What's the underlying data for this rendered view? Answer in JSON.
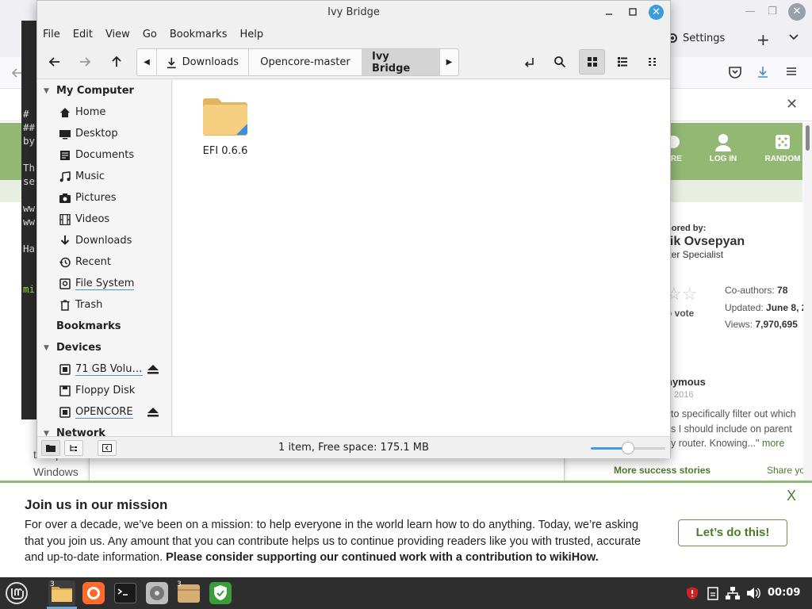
{
  "nemo": {
    "title": "Ivy Bridge",
    "menu": [
      "File",
      "Edit",
      "View",
      "Go",
      "Bookmarks",
      "Help"
    ],
    "path": [
      "Downloads",
      "Opencore-master",
      "Ivy Bridge"
    ],
    "sidebar": {
      "my_computer": "My Computer",
      "places": [
        {
          "label": "Home",
          "icon": "home-icon"
        },
        {
          "label": "Desktop",
          "icon": "desktop-icon"
        },
        {
          "label": "Documents",
          "icon": "documents-icon"
        },
        {
          "label": "Music",
          "icon": "music-icon"
        },
        {
          "label": "Pictures",
          "icon": "camera-icon"
        },
        {
          "label": "Videos",
          "icon": "film-icon"
        },
        {
          "label": "Downloads",
          "icon": "download-icon"
        },
        {
          "label": "Recent",
          "icon": "recent-icon"
        },
        {
          "label": "File System",
          "icon": "drive-icon"
        },
        {
          "label": "Trash",
          "icon": "trash-icon"
        }
      ],
      "bookmarks": "Bookmarks",
      "devices_header": "Devices",
      "devices": [
        {
          "label": "71 GB Volu…",
          "icon": "drive-icon",
          "eject": true
        },
        {
          "label": "Floppy Disk",
          "icon": "floppy-icon",
          "eject": false
        },
        {
          "label": "OPENCORE",
          "icon": "drive-icon",
          "eject": true
        }
      ],
      "network": "Network"
    },
    "files": [
      {
        "name": "EFI 0.6.6",
        "icon": "folder-icon"
      }
    ],
    "status": "1 item, Free space: 175.1 MB",
    "zoom_level": 0.5
  },
  "browser": {
    "settings_label": "Settings",
    "header_items": [
      "ORE",
      "LOG IN",
      "RANDOM"
    ],
    "author": {
      "line1": "-authored by:",
      "name": "arnik Ovsepyan",
      "role": "mputer Specialist"
    },
    "stats": {
      "coauthors_label": "Co-authors:",
      "coauthors": "78",
      "updated_label": "Updated:",
      "updated": "June 8, 2",
      "views_label": "Views:",
      "views": "7,970,695"
    },
    "vote": "o vote",
    "story": {
      "name": "nymous",
      "date": "2016",
      "l1": "to specifically filter out which",
      "l2": "s I should include on parent",
      "l3": "y router. Knowing...\"",
      "more": "more"
    },
    "more_stories": "More success stories",
    "share": "Share yo",
    "left_text": [
      "the quick",
      "Windows"
    ],
    "terminal_lines": [
      "#",
      "##",
      "by",
      "",
      "Th",
      "se",
      "",
      "ww",
      "ww",
      "",
      "Ha",
      "",
      "",
      "mi"
    ]
  },
  "banner": {
    "title": "Join us in our mission",
    "close": "X",
    "text": "For over a decade, we’ve been on a mission: to help everyone in the world learn how to do anything. Today, we’re asking that you join us. Any amount that you can contribute helps us to continue providing readers like you with trusted, accurate and up-to-date information. ",
    "text_bold": "Please consider supporting our continued work with a contribution to wikiHow.",
    "button": "Let’s do this!"
  },
  "taskbar": {
    "clock": "00:09",
    "badges": {
      "files": "3",
      "folder": "3"
    }
  }
}
